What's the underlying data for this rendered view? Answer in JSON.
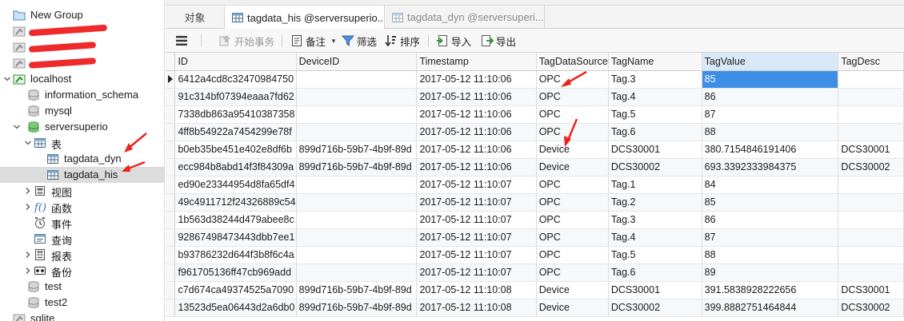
{
  "tree": {
    "nodes": [
      {
        "name": "tree-node-new-group",
        "label": "New Group",
        "icon": "folder-icon",
        "level": 0,
        "expanded": null
      },
      {
        "name": "tree-node-connection-1",
        "label": "",
        "icon": "connection-icon",
        "level": 0,
        "expanded": null,
        "redacted": true
      },
      {
        "name": "tree-node-connection-2",
        "label": "",
        "icon": "connection-icon",
        "level": 0,
        "expanded": null,
        "redacted": true
      },
      {
        "name": "tree-node-connection-3",
        "label": "",
        "icon": "connection-icon",
        "level": 0,
        "expanded": null,
        "redacted": true
      },
      {
        "name": "tree-node-localhost",
        "label": "localhost",
        "icon": "connection-open-icon",
        "level": 0,
        "expanded": true
      },
      {
        "name": "tree-node-information-schema",
        "label": "information_schema",
        "icon": "database-icon",
        "level": 1,
        "expanded": null
      },
      {
        "name": "tree-node-mysql",
        "label": "mysql",
        "icon": "database-icon",
        "level": 1,
        "expanded": null
      },
      {
        "name": "tree-node-serversuperio",
        "label": "serversuperio",
        "icon": "database-open-icon",
        "level": 1,
        "expanded": true
      },
      {
        "name": "tree-node-tables",
        "label": "表",
        "icon": "table-group-icon",
        "level": 2,
        "expanded": true
      },
      {
        "name": "tree-node-tagdata-dyn",
        "label": "tagdata_dyn",
        "icon": "table-icon",
        "level": 3,
        "expanded": null
      },
      {
        "name": "tree-node-tagdata-his",
        "label": "tagdata_his",
        "icon": "table-icon",
        "level": 3,
        "expanded": null,
        "selected": true
      },
      {
        "name": "tree-node-views",
        "label": "视图",
        "icon": "view-icon",
        "level": 2,
        "expanded": false
      },
      {
        "name": "tree-node-functions",
        "label": "函数",
        "icon": "function-icon",
        "level": 2,
        "expanded": false
      },
      {
        "name": "tree-node-events",
        "label": "事件",
        "icon": "event-icon",
        "level": 2,
        "expanded": null
      },
      {
        "name": "tree-node-queries",
        "label": "查询",
        "icon": "query-icon",
        "level": 2,
        "expanded": null
      },
      {
        "name": "tree-node-reports",
        "label": "报表",
        "icon": "report-icon",
        "level": 2,
        "expanded": false
      },
      {
        "name": "tree-node-backups",
        "label": "备份",
        "icon": "backup-icon",
        "level": 2,
        "expanded": false
      },
      {
        "name": "tree-node-test",
        "label": "test",
        "icon": "database-icon",
        "level": 1,
        "expanded": null
      },
      {
        "name": "tree-node-test2",
        "label": "test2",
        "icon": "database-icon",
        "level": 1,
        "expanded": null
      },
      {
        "name": "tree-node-sqlite",
        "label": "sqlite",
        "icon": "connection-icon",
        "level": 0,
        "expanded": null
      }
    ]
  },
  "tabs": [
    {
      "label": "对象",
      "state": "plain"
    },
    {
      "label": "tagdata_his @serversuperio...",
      "state": "active",
      "icon": "table-icon"
    },
    {
      "label": "tagdata_dyn @serversuperi...",
      "state": "inactive",
      "icon": "table-icon"
    }
  ],
  "toolbar": {
    "menu_icon": "hamburger-menu-icon",
    "begin_transaction": "开始事务",
    "memo": "备注",
    "filter": "筛选",
    "sort": "排序",
    "import": "导入",
    "export": "导出"
  },
  "grid": {
    "columns": [
      "ID",
      "DeviceID",
      "Timestamp",
      "TagDataSource",
      "TagName",
      "TagValue",
      "TagDesc"
    ],
    "selected_column": "TagValue",
    "rows": [
      [
        "6412a4cd8c32470984750",
        "",
        "2017-05-12 11:10:06",
        "OPC",
        "Tag.3",
        "85",
        ""
      ],
      [
        "91c314bf07394eaaa7fd62",
        "",
        "2017-05-12 11:10:06",
        "OPC",
        "Tag.4",
        "86",
        ""
      ],
      [
        "7338db863a95410387358",
        "",
        "2017-05-12 11:10:06",
        "OPC",
        "Tag.5",
        "87",
        ""
      ],
      [
        "4ff8b54922a7454299e78f",
        "",
        "2017-05-12 11:10:06",
        "OPC",
        "Tag.6",
        "88",
        ""
      ],
      [
        "b0eb35be451e402e8df6b",
        "899d716b-59b7-4b9f-89d",
        "2017-05-12 11:10:06",
        "Device",
        "DCS30001",
        "380.7154846191406",
        "DCS30001"
      ],
      [
        "ecc984b8abd14f3f84309a",
        "899d716b-59b7-4b9f-89d",
        "2017-05-12 11:10:06",
        "Device",
        "DCS30002",
        "693.3392333984375",
        "DCS30002"
      ],
      [
        "ed90e23344954d8fa65df4",
        "",
        "2017-05-12 11:10:07",
        "OPC",
        "Tag.1",
        "84",
        ""
      ],
      [
        "49c4911712f24326889c54",
        "",
        "2017-05-12 11:10:07",
        "OPC",
        "Tag.2",
        "85",
        ""
      ],
      [
        "1b563d38244d479abee8c",
        "",
        "2017-05-12 11:10:07",
        "OPC",
        "Tag.3",
        "86",
        ""
      ],
      [
        "92867498473443dbb7ee1",
        "",
        "2017-05-12 11:10:07",
        "OPC",
        "Tag.4",
        "87",
        ""
      ],
      [
        "b93786232d644f3b8f6c4a",
        "",
        "2017-05-12 11:10:07",
        "OPC",
        "Tag.5",
        "88",
        ""
      ],
      [
        "f961705136ff47cb969add",
        "",
        "2017-05-12 11:10:07",
        "OPC",
        "Tag.6",
        "89",
        ""
      ],
      [
        "c7d674ca49374525a7090",
        "899d716b-59b7-4b9f-89d",
        "2017-05-12 11:10:08",
        "Device",
        "DCS30001",
        "391.5838928222656",
        "DCS30001"
      ],
      [
        "13523d5ea06443d2a6db0",
        "899d716b-59b7-4b9f-89d",
        "2017-05-12 11:10:08",
        "Device",
        "DCS30002",
        "399.8882751464844",
        "DCS30002"
      ]
    ],
    "current_row": 0,
    "active_cell": "TagValue"
  },
  "colors": {
    "accent": "#3e8ee6",
    "annotation_arrow": "#e8261d",
    "redaction": "#ee2a2a",
    "database_green": "#3aa53a"
  }
}
